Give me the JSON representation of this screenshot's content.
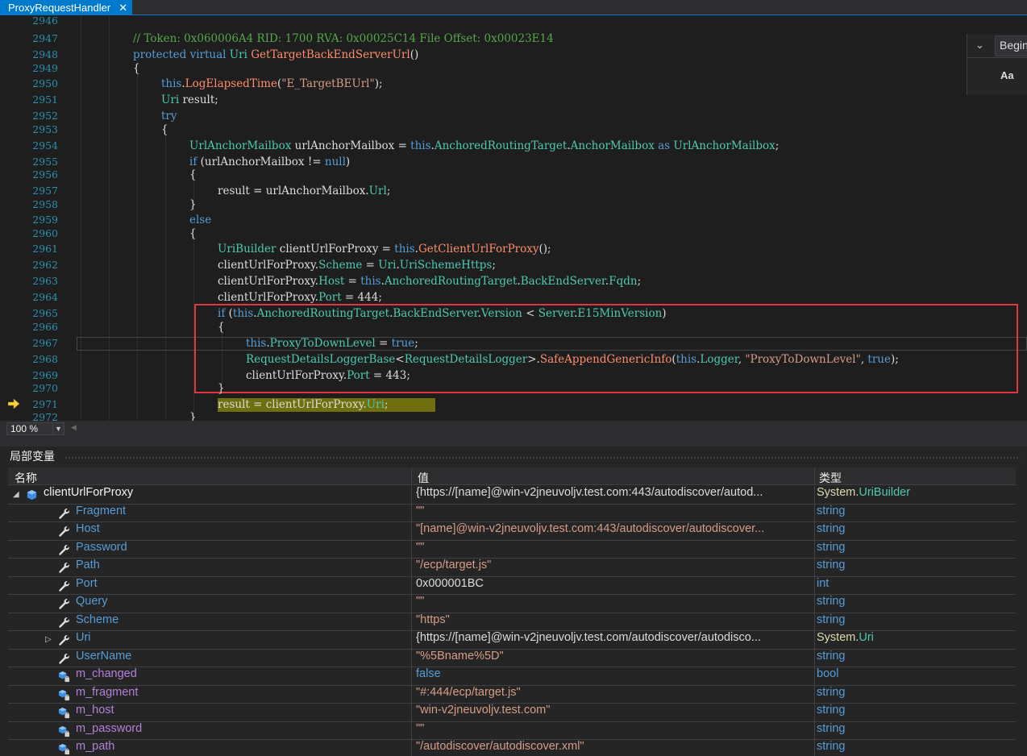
{
  "tab": {
    "title": "ProxyRequestHandler",
    "close": "✕"
  },
  "editor": {
    "lines": [
      {
        "n": "2946",
        "t": ""
      },
      {
        "n": "2947",
        "t": "comment"
      },
      {
        "n": "2948",
        "t": "sig"
      },
      {
        "n": "2949",
        "t": "{"
      },
      {
        "n": "2950",
        "t": "log"
      },
      {
        "n": "2951",
        "t": "uri"
      },
      {
        "n": "2952",
        "t": "try"
      },
      {
        "n": "2953",
        "t": "{"
      },
      {
        "n": "2954",
        "t": "anchor"
      },
      {
        "n": "2955",
        "t": "ifnull"
      },
      {
        "n": "2956",
        "t": "{"
      },
      {
        "n": "2957",
        "t": "res1"
      },
      {
        "n": "2958",
        "t": "}"
      },
      {
        "n": "2959",
        "t": "else"
      },
      {
        "n": "2960",
        "t": "{"
      },
      {
        "n": "2961",
        "t": "builder"
      },
      {
        "n": "2962",
        "t": "scheme"
      },
      {
        "n": "2963",
        "t": "host"
      },
      {
        "n": "2964",
        "t": "port444"
      },
      {
        "n": "2965",
        "t": "ifver"
      },
      {
        "n": "2966",
        "t": "{"
      },
      {
        "n": "2967",
        "t": "down"
      },
      {
        "n": "2968",
        "t": "append"
      },
      {
        "n": "2969",
        "t": "port443"
      },
      {
        "n": "2970",
        "t": "}"
      },
      {
        "n": "2971",
        "t": "result"
      },
      {
        "n": "2972",
        "t": "}"
      }
    ],
    "text": {
      "comment": "// Token: 0x060006A4 RID: 1700 RVA: 0x00025C14 File Offset: 0x00023E14",
      "kw_protected": "protected",
      "kw_virtual": "virtual",
      "ty_uri": "Uri",
      "fn_get": "GetTargetBackEndServerUrl",
      "parens": "()",
      "brace_open": "{",
      "brace_close": "}",
      "kw_this": "this",
      "fn_log": "LogElapsedTime",
      "str_e": "\"E_TargetBEUrl\"",
      "id_result": "result",
      "kw_try": "try",
      "ty_anchor": "UrlAnchorMailbox",
      "id_anchor": "urlAnchorMailbox",
      "pr_art": "AnchoredRoutingTarget",
      "pr_am": "AnchorMailbox",
      "kw_as": "as",
      "kw_if": "if",
      "kw_null": "null",
      "pr_url": "Url",
      "kw_else": "else",
      "ty_builder": "UriBuilder",
      "id_client": "clientUrlForProxy",
      "fn_getclient": "GetClientUrlForProxy",
      "pr_scheme": "Scheme",
      "pr_https": "UriSchemeHttps",
      "pr_host": "Host",
      "pr_bes": "BackEndServer",
      "pr_fqdn": "Fqdn",
      "pr_port": "Port",
      "num_444": "444",
      "num_443": "443",
      "pr_version": "Version",
      "ty_server": "Server",
      "pr_e15": "E15MinVersion",
      "pr_ptdl": "ProxyToDownLevel",
      "kw_true": "true",
      "ty_rdlb": "RequestDetailsLoggerBase",
      "ty_rdl": "RequestDetailsLogger",
      "fn_safe": "SafeAppendGenericInfo",
      "pr_logger": "Logger",
      "str_ptdl": "\"ProxyToDownLevel\"",
      "pr_uri": "Uri"
    }
  },
  "find": {
    "search_text": "Begin",
    "case_label": "Aa"
  },
  "zoom": {
    "value": "100 %"
  },
  "locals": {
    "title": "局部变量",
    "columns": {
      "name": "名称",
      "value": "值",
      "type": "类型"
    },
    "rows": [
      {
        "name": "clientUrlForProxy",
        "kind": "top",
        "expand": "down",
        "value": "{https://[name]@win-v2jneuvoljv.test.com:443/autodiscover/autod...",
        "vkind": "plain",
        "type_ns": "System.",
        "type_name": "UriBuilder",
        "tkind": "sys"
      },
      {
        "name": "Fragment",
        "kind": "prop",
        "value": "\"\"",
        "vkind": "str",
        "type_name": "string"
      },
      {
        "name": "Host",
        "kind": "prop",
        "value": "\"[name]@win-v2jneuvoljv.test.com:443/autodiscover/autodiscover...",
        "vkind": "str",
        "type_name": "string"
      },
      {
        "name": "Password",
        "kind": "prop",
        "value": "\"\"",
        "vkind": "str",
        "type_name": "string"
      },
      {
        "name": "Path",
        "kind": "prop",
        "value": "\"/ecp/target.js\"",
        "vkind": "str",
        "type_name": "string"
      },
      {
        "name": "Port",
        "kind": "prop",
        "value": "0x000001BC",
        "vkind": "plain",
        "type_name": "int"
      },
      {
        "name": "Query",
        "kind": "prop",
        "value": "\"\"",
        "vkind": "str",
        "type_name": "string"
      },
      {
        "name": "Scheme",
        "kind": "prop",
        "value": "\"https\"",
        "vkind": "str",
        "type_name": "string"
      },
      {
        "name": "Uri",
        "kind": "prop",
        "expand": "right",
        "value": "{https://[name]@win-v2jneuvoljv.test.com/autodiscover/autodisco...",
        "vkind": "plain",
        "type_ns": "System.",
        "type_name": "Uri",
        "tkind": "sys"
      },
      {
        "name": "UserName",
        "kind": "prop",
        "value": "\"%5Bname%5D\"",
        "vkind": "str",
        "type_name": "string"
      },
      {
        "name": "m_changed",
        "kind": "field",
        "value": "false",
        "vkind": "kw",
        "type_name": "bool"
      },
      {
        "name": "m_fragment",
        "kind": "field",
        "value": "\"#:444/ecp/target.js\"",
        "vkind": "str",
        "type_name": "string"
      },
      {
        "name": "m_host",
        "kind": "field",
        "value": "\"win-v2jneuvoljv.test.com\"",
        "vkind": "str",
        "type_name": "string"
      },
      {
        "name": "m_password",
        "kind": "field",
        "value": "\"\"",
        "vkind": "str",
        "type_name": "string"
      },
      {
        "name": "m_path",
        "kind": "field",
        "value": "\"/autodiscover/autodiscover.xml\"",
        "vkind": "str",
        "type_name": "string"
      }
    ]
  },
  "colors": {
    "accent": "#007acc",
    "highlight_box": "#e0383a",
    "current_line": "#b3b300"
  }
}
